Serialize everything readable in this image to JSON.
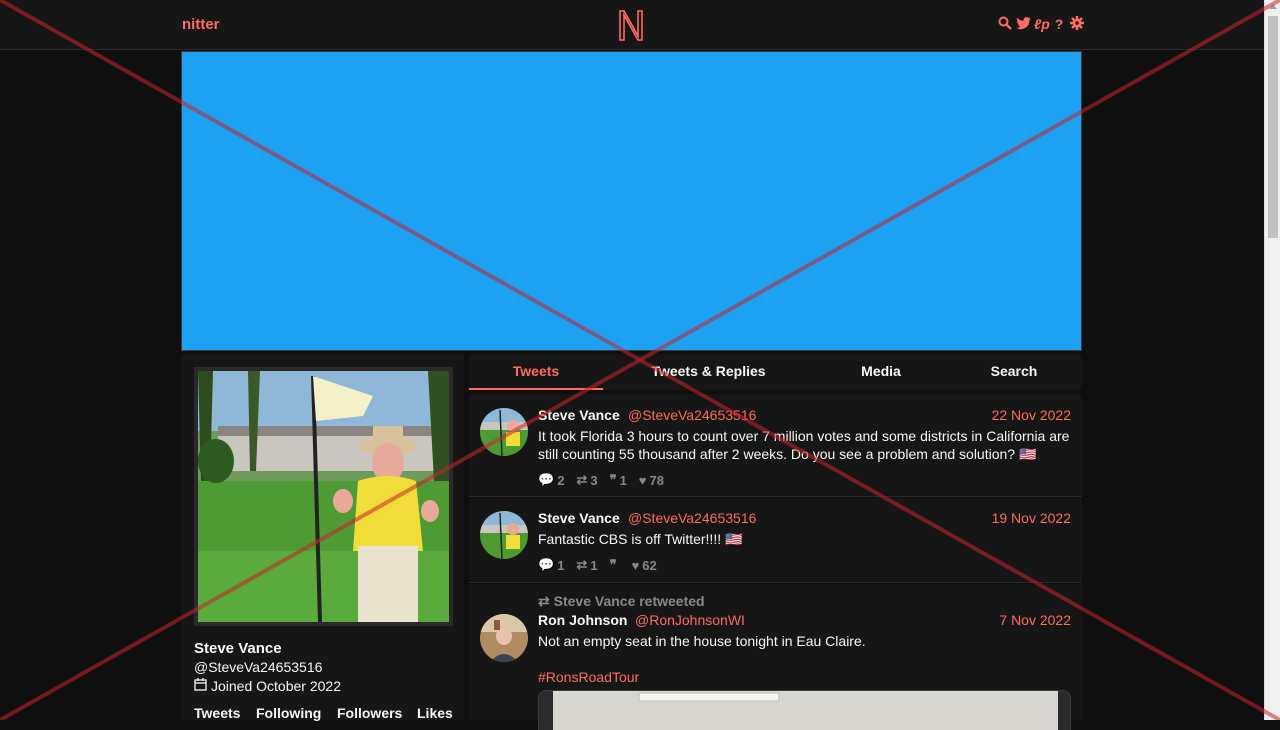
{
  "nav": {
    "brand": "nitter",
    "icons": [
      "search-icon",
      "twitter-icon",
      "rss-icon",
      "help-icon",
      "settings-icon"
    ]
  },
  "profile": {
    "name": "Steve Vance",
    "handle": "@SteveVa24653516",
    "joined": "Joined October 2022",
    "stats": [
      "Tweets",
      "Following",
      "Followers",
      "Likes"
    ]
  },
  "tabs": [
    {
      "label": "Tweets",
      "active": true
    },
    {
      "label": "Tweets & Replies",
      "active": false
    },
    {
      "label": "Media",
      "active": false
    },
    {
      "label": "Search",
      "active": false
    }
  ],
  "tweets": [
    {
      "fullname": "Steve Vance",
      "username": "@SteveVa24653516",
      "date": "22 Nov 2022",
      "text": "It took Florida 3 hours to count over 7 million votes and some districts in California are still counting 55 thousand after 2 weeks. Do you see a problem and solution? 🇺🇸",
      "replies": "2",
      "retweets": "3",
      "quotes": "1",
      "likes": "78"
    },
    {
      "fullname": "Steve Vance",
      "username": "@SteveVa24653516",
      "date": "19 Nov 2022",
      "text": "Fantastic CBS is off Twitter!!!! 🇺🇸",
      "replies": "1",
      "retweets": "1",
      "quotes": "",
      "likes": "62"
    },
    {
      "retweeted_by": "Steve Vance retweeted",
      "fullname": "Ron Johnson",
      "username": "@RonJohnsonWI",
      "date": "7 Nov 2022",
      "text": "Not an empty seat in the house tonight in Eau Claire.",
      "hashtag": "#RonsRoadTour"
    }
  ],
  "colors": {
    "accent": "#ff6c60",
    "banner": "#1da1f2",
    "background": "#0f0f0f",
    "panel": "#161616"
  }
}
